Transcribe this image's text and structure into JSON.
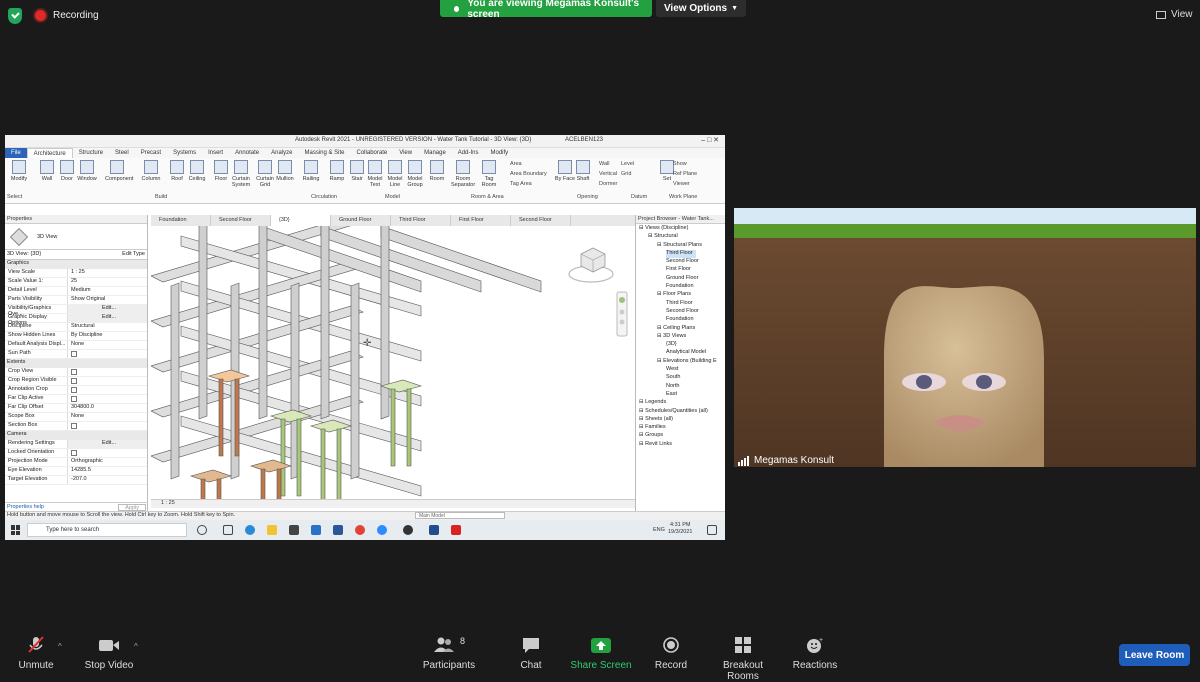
{
  "top": {
    "recording_label": "Recording",
    "share_banner": "You are viewing Megamas Konsult's screen",
    "view_options": "View Options",
    "view_label": "View"
  },
  "revit": {
    "window_title": "Autodesk Revit 2021 - UNREGISTERED VERSION - Water Tank Tutorial - 3D View: {3D}",
    "user": "ACELBEN123",
    "menu_tabs": [
      "File",
      "Architecture",
      "Structure",
      "Steel",
      "Precast",
      "Systems",
      "Insert",
      "Annotate",
      "Analyze",
      "Massing & Site",
      "Collaborate",
      "View",
      "Manage",
      "Add-Ins",
      "Modify"
    ],
    "ribbon_buttons": [
      "Modify",
      "Wall",
      "Door",
      "Window",
      "Component",
      "Column",
      "Roof",
      "Ceiling",
      "Floor",
      "Curtain System",
      "Curtain Grid",
      "Mullion",
      "Railing",
      "Ramp",
      "Stair",
      "Model Text",
      "Model Line",
      "Model Group",
      "Room",
      "Room Separator",
      "Tag Room",
      "By Face",
      "Shaft",
      "Set"
    ],
    "ribbon_small": [
      "Area",
      "Area Boundary",
      "Tag Area",
      "Wall",
      "Vertical",
      "Dormer",
      "Level",
      "Grid",
      "Show",
      "Ref Plane",
      "Viewer"
    ],
    "ribbon_groups": [
      "Select",
      "Build",
      "Circulation",
      "Model",
      "Room & Area",
      "Opening",
      "Datum",
      "Work Plane"
    ],
    "properties": {
      "header": "Properties",
      "type": "3D View",
      "instance": "3D View: {3D}",
      "edit_type": "Edit Type",
      "sections": [
        {
          "title": "Graphics",
          "rows": [
            [
              "View Scale",
              "1 : 25"
            ],
            [
              "Scale Value 1:",
              "25"
            ],
            [
              "Detail Level",
              "Medium"
            ],
            [
              "Parts Visibility",
              "Show Original"
            ],
            [
              "Visibility/Graphics Ove...",
              "Edit..."
            ],
            [
              "Graphic Display Options",
              "Edit..."
            ],
            [
              "Discipline",
              "Structural"
            ],
            [
              "Show Hidden Lines",
              "By Discipline"
            ],
            [
              "Default Analysis Displ...",
              "None"
            ],
            [
              "Sun Path",
              ""
            ]
          ]
        },
        {
          "title": "Extents",
          "rows": [
            [
              "Crop View",
              ""
            ],
            [
              "Crop Region Visible",
              ""
            ],
            [
              "Annotation Crop",
              ""
            ],
            [
              "Far Clip Active",
              ""
            ],
            [
              "Far Clip Offset",
              "304800.0"
            ],
            [
              "Scope Box",
              "None"
            ],
            [
              "Section Box",
              ""
            ]
          ]
        },
        {
          "title": "Camera",
          "rows": [
            [
              "Rendering Settings",
              "Edit..."
            ],
            [
              "Locked Orientation",
              ""
            ],
            [
              "Projection Mode",
              "Orthographic"
            ],
            [
              "Eye Elevation",
              "14285.5"
            ],
            [
              "Target Elevation",
              "-207.0"
            ]
          ]
        }
      ],
      "help": "Properties help",
      "apply": "Apply"
    },
    "view_tabs": [
      "Foundation",
      "Second Floor",
      "{3D}",
      "Ground Floor",
      "Third Floor",
      "First Floor",
      "Second Floor"
    ],
    "scale_bar": "1 : 25",
    "browser": {
      "header": "Project Browser - Water Tank...",
      "items": [
        {
          "t": "Views (Discipline)",
          "l": 0
        },
        {
          "t": "Structural",
          "l": 1
        },
        {
          "t": "Structural Plans",
          "l": 2
        },
        {
          "t": "Third Floor",
          "l": 3,
          "sel": true
        },
        {
          "t": "Second Floor",
          "l": 3
        },
        {
          "t": "First Floor",
          "l": 3
        },
        {
          "t": "Ground Floor",
          "l": 3
        },
        {
          "t": "Foundation",
          "l": 3
        },
        {
          "t": "Floor Plans",
          "l": 2
        },
        {
          "t": "Third Floor",
          "l": 3
        },
        {
          "t": "Second Floor",
          "l": 3
        },
        {
          "t": "Foundation",
          "l": 3
        },
        {
          "t": "Ceiling Plans",
          "l": 2
        },
        {
          "t": "3D Views",
          "l": 2
        },
        {
          "t": "{3D}",
          "l": 3
        },
        {
          "t": "Analytical Model",
          "l": 3
        },
        {
          "t": "Elevations (Building E",
          "l": 2
        },
        {
          "t": "West",
          "l": 3
        },
        {
          "t": "South",
          "l": 3
        },
        {
          "t": "North",
          "l": 3
        },
        {
          "t": "East",
          "l": 3
        },
        {
          "t": "Legends",
          "l": 0
        },
        {
          "t": "Schedules/Quantities (all)",
          "l": 0
        },
        {
          "t": "Sheets (all)",
          "l": 0
        },
        {
          "t": "Families",
          "l": 0
        },
        {
          "t": "Groups",
          "l": 0
        },
        {
          "t": "Revit Links",
          "l": 0
        }
      ]
    },
    "status_text": "Hold button and move mouse to Scroll the view. Hold Ctrl key to Zoom. Hold Shift key to Spin.",
    "main_model": "Main Model",
    "taskbar": {
      "search": "Type here to search",
      "time": "4:31 PM",
      "date": "19/3/2021",
      "lang": "ENG"
    }
  },
  "camera": {
    "participant_name": "Megamas Konsult"
  },
  "controls": {
    "unmute": "Unmute",
    "stop_video": "Stop Video",
    "participants": "Participants",
    "participant_count": "8",
    "chat": "Chat",
    "share_screen": "Share Screen",
    "record": "Record",
    "breakout": "Breakout Rooms",
    "reactions": "Reactions",
    "leave": "Leave Room"
  },
  "colors": {
    "accent_green": "#23a040",
    "leave_blue": "#1f5dba",
    "revit_file_blue": "#2b64b8"
  }
}
